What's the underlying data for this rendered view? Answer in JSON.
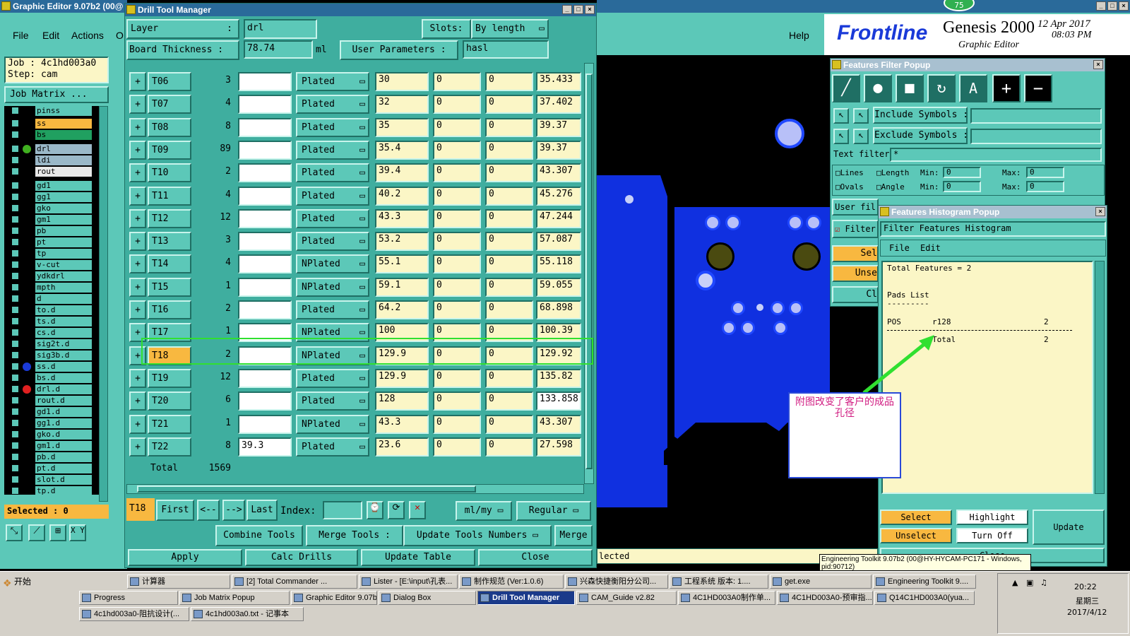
{
  "graphic_editor": {
    "title": "Graphic Editor 9.07b2 (00@",
    "menu": [
      "File",
      "Edit",
      "Actions",
      "O"
    ],
    "help": "Help",
    "job": "Job : 4c1hd003a0",
    "step": "Step: cam",
    "job_matrix": "Job Matrix ...",
    "selected": "Selected : 0",
    "xy_label": "X Y :",
    "layers": [
      {
        "name": "pinss",
        "color": "#5cc8b8",
        "dot": ""
      },
      {
        "name": "ss",
        "color": "#f8b840",
        "dot": ""
      },
      {
        "name": "bs",
        "color": "#20a060",
        "dot": ""
      },
      {
        "name": "drl",
        "color": "#9ab8c8",
        "dot": "#40b020"
      },
      {
        "name": "ldi",
        "color": "#9ab8c8",
        "dot": ""
      },
      {
        "name": "rout",
        "color": "#e8e8e8",
        "dot": ""
      },
      {
        "name": "gd1",
        "color": "#5cc8b8",
        "dot": ""
      },
      {
        "name": "gg1",
        "color": "#5cc8b8",
        "dot": ""
      },
      {
        "name": "gko",
        "color": "#5cc8b8",
        "dot": ""
      },
      {
        "name": "gm1",
        "color": "#5cc8b8",
        "dot": ""
      },
      {
        "name": "pb",
        "color": "#5cc8b8",
        "dot": ""
      },
      {
        "name": "pt",
        "color": "#5cc8b8",
        "dot": ""
      },
      {
        "name": "tp",
        "color": "#5cc8b8",
        "dot": ""
      },
      {
        "name": "v-cut",
        "color": "#5cc8b8",
        "dot": ""
      },
      {
        "name": "ydkdrl",
        "color": "#5cc8b8",
        "dot": ""
      },
      {
        "name": "mpth",
        "color": "#5cc8b8",
        "dot": ""
      },
      {
        "name": "d",
        "color": "#5cc8b8",
        "dot": ""
      },
      {
        "name": "to.d",
        "color": "#5cc8b8",
        "dot": ""
      },
      {
        "name": "ts.d",
        "color": "#5cc8b8",
        "dot": ""
      },
      {
        "name": "cs.d",
        "color": "#5cc8b8",
        "dot": ""
      },
      {
        "name": "sig2t.d",
        "color": "#5cc8b8",
        "dot": ""
      },
      {
        "name": "sig3b.d",
        "color": "#5cc8b8",
        "dot": ""
      },
      {
        "name": "ss.d",
        "color": "#5cc8b8",
        "dot": "#1a3ad8"
      },
      {
        "name": "bs.d",
        "color": "#5cc8b8",
        "dot": ""
      },
      {
        "name": "drl.d",
        "color": "#5cc8b8",
        "dot": "#e02020"
      },
      {
        "name": "rout.d",
        "color": "#5cc8b8",
        "dot": ""
      },
      {
        "name": "gd1.d",
        "color": "#5cc8b8",
        "dot": ""
      },
      {
        "name": "gg1.d",
        "color": "#5cc8b8",
        "dot": ""
      },
      {
        "name": "gko.d",
        "color": "#5cc8b8",
        "dot": ""
      },
      {
        "name": "gm1.d",
        "color": "#5cc8b8",
        "dot": ""
      },
      {
        "name": "pb.d",
        "color": "#5cc8b8",
        "dot": ""
      },
      {
        "name": "pt.d",
        "color": "#5cc8b8",
        "dot": ""
      },
      {
        "name": "slot.d",
        "color": "#5cc8b8",
        "dot": ""
      },
      {
        "name": "tp.d",
        "color": "#5cc8b8",
        "dot": ""
      }
    ]
  },
  "drill": {
    "title": "Drill Tool Manager",
    "layer_label": "Layer",
    "layer_colon": ":",
    "layer_value": "drl",
    "slots_label": "Slots:",
    "slots_value": "By length",
    "thickness_label": "Board Thickness :",
    "thickness_value": "78.74",
    "thickness_unit": "ml",
    "user_params_label": "User Parameters :",
    "user_params_value": "hasl",
    "rows": [
      {
        "tool": "T06",
        "count": "3",
        "size": "",
        "type": "Plated",
        "v1": "30",
        "v2": "0",
        "v3": "0",
        "fin": "35.433"
      },
      {
        "tool": "T07",
        "count": "4",
        "size": "",
        "type": "Plated",
        "v1": "32",
        "v2": "0",
        "v3": "0",
        "fin": "37.402"
      },
      {
        "tool": "T08",
        "count": "8",
        "size": "",
        "type": "Plated",
        "v1": "35",
        "v2": "0",
        "v3": "0",
        "fin": "39.37"
      },
      {
        "tool": "T09",
        "count": "89",
        "size": "",
        "type": "Plated",
        "v1": "35.4",
        "v2": "0",
        "v3": "0",
        "fin": "39.37"
      },
      {
        "tool": "T10",
        "count": "2",
        "size": "",
        "type": "Plated",
        "v1": "39.4",
        "v2": "0",
        "v3": "0",
        "fin": "43.307"
      },
      {
        "tool": "T11",
        "count": "4",
        "size": "",
        "type": "Plated",
        "v1": "40.2",
        "v2": "0",
        "v3": "0",
        "fin": "45.276"
      },
      {
        "tool": "T12",
        "count": "12",
        "size": "",
        "type": "Plated",
        "v1": "43.3",
        "v2": "0",
        "v3": "0",
        "fin": "47.244"
      },
      {
        "tool": "T13",
        "count": "3",
        "size": "",
        "type": "Plated",
        "v1": "53.2",
        "v2": "0",
        "v3": "0",
        "fin": "57.087"
      },
      {
        "tool": "T14",
        "count": "4",
        "size": "",
        "type": "NPlated",
        "v1": "55.1",
        "v2": "0",
        "v3": "0",
        "fin": "55.118"
      },
      {
        "tool": "T15",
        "count": "1",
        "size": "",
        "type": "NPlated",
        "v1": "59.1",
        "v2": "0",
        "v3": "0",
        "fin": "59.055"
      },
      {
        "tool": "T16",
        "count": "2",
        "size": "",
        "type": "Plated",
        "v1": "64.2",
        "v2": "0",
        "v3": "0",
        "fin": "68.898"
      },
      {
        "tool": "T17",
        "count": "1",
        "size": "",
        "type": "NPlated",
        "v1": "100",
        "v2": "0",
        "v3": "0",
        "fin": "100.39"
      },
      {
        "tool": "T18",
        "count": "2",
        "size": "",
        "type": "NPlated",
        "v1": "129.9",
        "v2": "0",
        "v3": "0",
        "fin": "129.92"
      },
      {
        "tool": "T19",
        "count": "12",
        "size": "",
        "type": "Plated",
        "v1": "129.9",
        "v2": "0",
        "v3": "0",
        "fin": "135.82"
      },
      {
        "tool": "T20",
        "count": "6",
        "size": "",
        "type": "Plated",
        "v1": "128",
        "v2": "0",
        "v3": "0",
        "fin": "133.858"
      },
      {
        "tool": "T21",
        "count": "1",
        "size": "",
        "type": "NPlated",
        "v1": "43.3",
        "v2": "0",
        "v3": "0",
        "fin": "43.307"
      },
      {
        "tool": "T22",
        "count": "8",
        "size": "39.3",
        "type": "Plated",
        "v1": "23.6",
        "v2": "0",
        "v3": "0",
        "fin": "27.598"
      }
    ],
    "total_label": "Total",
    "total_value": "1569",
    "current_tool": "T18",
    "first": "First",
    "prev": "<--",
    "next": "-->",
    "last": "Last",
    "index_label": "Index:",
    "units": "ml/my",
    "regular": "Regular",
    "combine": "Combine Tools",
    "merge_tools": "Merge Tools :",
    "update_numbers": "Update Tools Numbers",
    "merge": "Merge",
    "apply": "Apply",
    "calc": "Calc Drills",
    "update_table": "Update Table",
    "close": "Close"
  },
  "genesis": {
    "brand": "Frontline",
    "product": "Genesis 2000",
    "sub": "Graphic Editor",
    "date": "12 Apr 2017",
    "time": "08:03 PM",
    "badge": "75"
  },
  "filter": {
    "title": "Features Filter Popup",
    "include": "Include Symbols :",
    "exclude": "Exclude Symbols :",
    "text_filter": "Text filter",
    "text_value": "*",
    "lines": "Lines",
    "ovals": "Ovals",
    "length": "Length",
    "angle": "Angle",
    "min": "Min:",
    "max": "Max:",
    "min_val": "0",
    "max_val": "0",
    "user_fil": "User fil",
    "filter": "Filter",
    "sel": "Sel",
    "unse": "Unse",
    "cl": "Cl"
  },
  "histogram": {
    "title": "Features Histogram Popup",
    "header": "Filter Features Histogram",
    "menu": [
      "File",
      "Edit"
    ],
    "total_line": "Total Features = 2",
    "pads": "Pads List",
    "dashes": "---------",
    "pos": "POS",
    "sym": "r128",
    "cnt": "2",
    "total": "Total",
    "total_cnt": "2",
    "select": "Select",
    "highlight": "Highlight",
    "update": "Update",
    "unselect": "Unselect",
    "turnoff": "Turn Off",
    "close": "Close"
  },
  "annotation": {
    "text": "附图改变了客户的成品孔径"
  },
  "statusbar": {
    "selected": "lected",
    "tooltip": "Engineering Toolkit 9.07b2 (00@HY-HYCAM-PC171 - Windows, pid:90712)"
  },
  "taskbar": {
    "start": "开始",
    "row1": [
      "计算器",
      "[2] Total Commander ...",
      "Lister - [E:\\input\\孔表...",
      "制作规范 (Ver:1.0.6)",
      "兴森快捷衡阳分公司...",
      "工程系统 版本: 1....",
      "get.exe",
      "Engineering Toolkit 9...."
    ],
    "row2": [
      "Progress",
      "Job Matrix Popup",
      "Graphic Editor 9.07b2...",
      "Dialog Box",
      "Drill Tool Manager",
      "CAM_Guide v2.82",
      "4C1HD003A0制作单...",
      "4C1HD003A0-预审指...",
      "Q14C1HD003A0(yua..."
    ],
    "row3": [
      "4c1hd003a0-阻抗设计(...",
      "4c1hd003a0.txt - 记事本"
    ],
    "clock": "20:22",
    "weekday": "星期三",
    "date": "2017/4/12"
  }
}
